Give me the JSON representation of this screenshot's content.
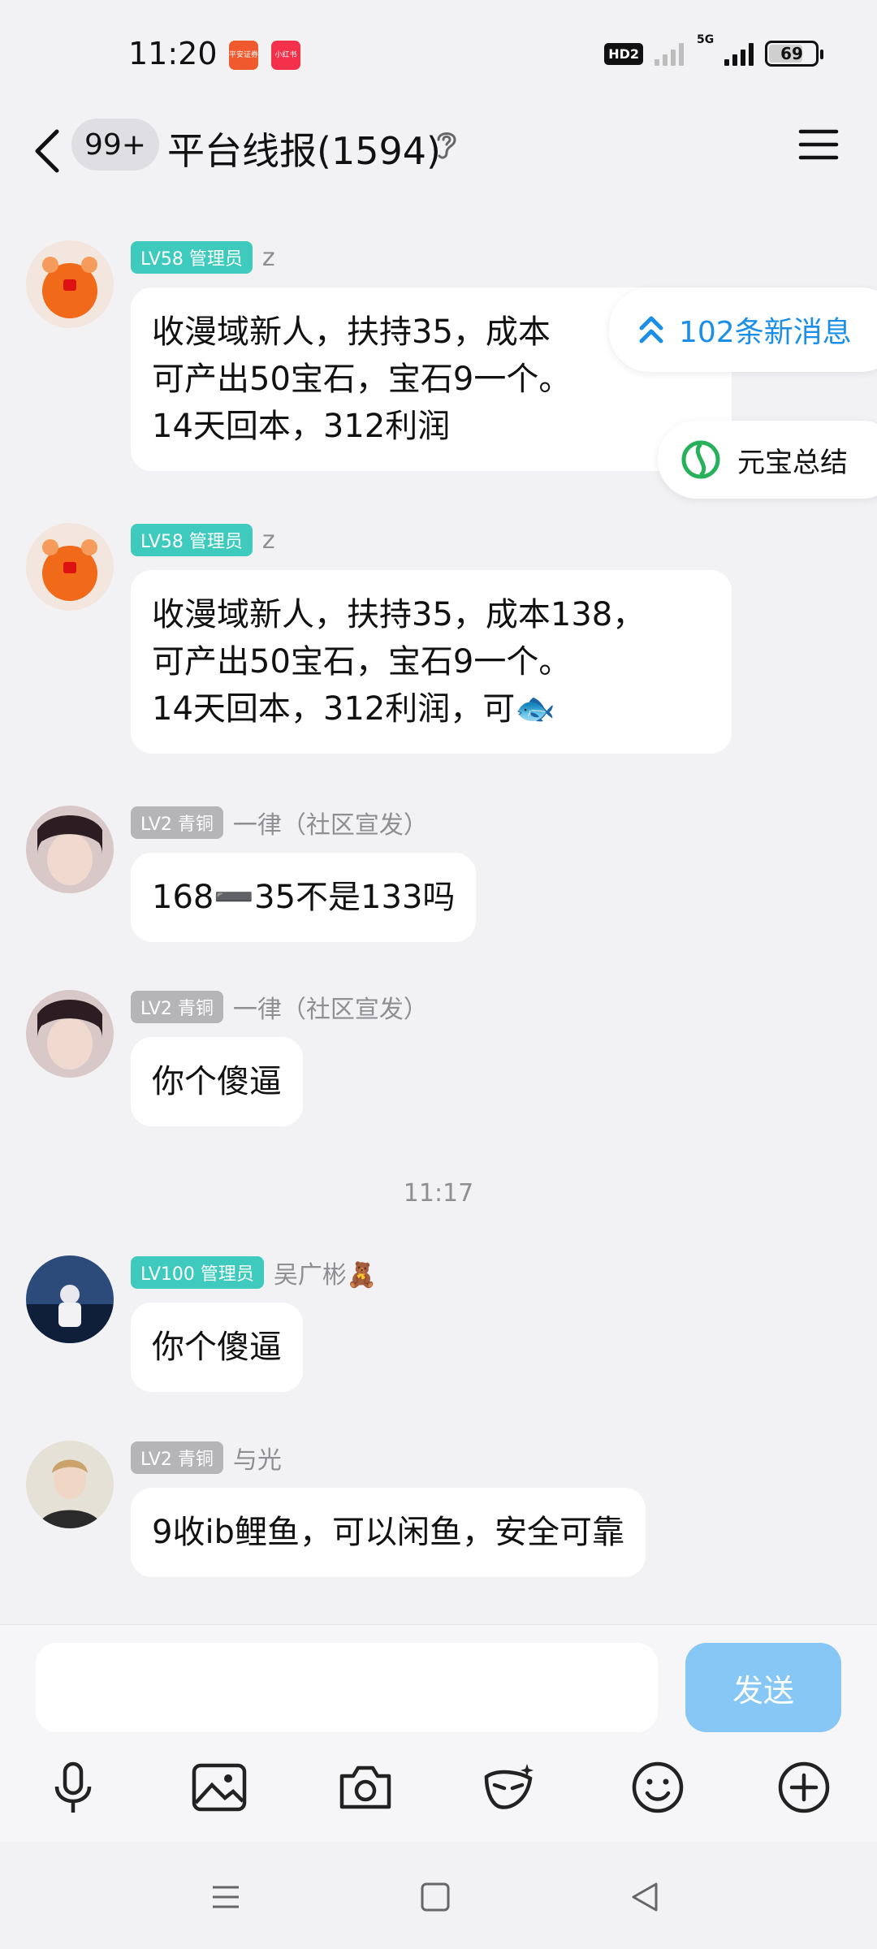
{
  "status_bar": {
    "time": "11:20",
    "apps": [
      {
        "label": "平安证券",
        "color": "#f0582d"
      },
      {
        "label": "小红书",
        "color": "#f5304a"
      }
    ],
    "hd_label": "HD2",
    "network_label": "5G",
    "battery": "69"
  },
  "header": {
    "unread_badge": "99+",
    "title": "平台线报(1594)"
  },
  "floating": {
    "new_messages": "102条新消息",
    "summary": "元宝总结"
  },
  "messages": [
    {
      "level": "LV58 管理员",
      "sender": "z",
      "lines": [
        "收漫域新人，扶持35，成本",
        "可产出50宝石，宝石9一个。",
        "14天回本，312利润"
      ]
    },
    {
      "level": "LV58 管理员",
      "sender": "z",
      "lines": [
        "收漫域新人，扶持35，成本138，",
        "可产出50宝石，宝石9一个。",
        "14天回本，312利润，可🐟"
      ]
    },
    {
      "level": "LV2 青铜",
      "sender": "一律（社区宣发）",
      "lines": [
        "168➖35不是133吗"
      ]
    },
    {
      "level": "LV2 青铜",
      "sender": "一律（社区宣发）",
      "lines": [
        "你个傻逼"
      ]
    },
    {
      "level": "LV100 管理员",
      "sender": "吴广彬🧸",
      "lines": [
        "你个傻逼"
      ]
    },
    {
      "level": "LV2 青铜",
      "sender": "与光",
      "lines": [
        "9收ib鲤鱼，可以闲鱼，安全可靠"
      ]
    }
  ],
  "time_divider": "11:17",
  "composer": {
    "input_value": "",
    "send_label": "发送"
  },
  "colors": {
    "accent": "#1b8fe8",
    "admin_tag": "#3ecbbd",
    "bronze_tag": "#b5b5b8",
    "send_button": "#86c7f5"
  },
  "toolbar_icons": [
    "microphone-icon",
    "image-icon",
    "camera-icon",
    "mask-icon",
    "emoji-icon",
    "plus-circle-icon"
  ],
  "nav_icons": [
    "menu-icon",
    "home-square-icon",
    "back-triangle-icon"
  ]
}
